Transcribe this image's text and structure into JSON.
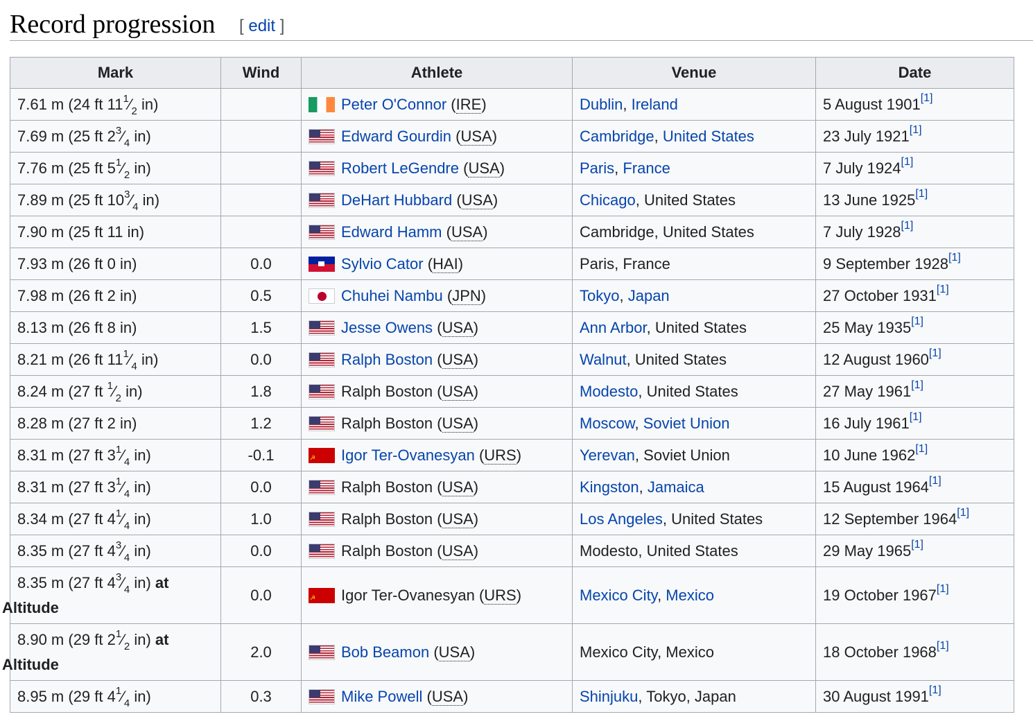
{
  "page": {
    "heading": "Record progression",
    "edit_open": "[ ",
    "edit_label": "edit",
    "edit_close": " ]"
  },
  "table": {
    "headers": [
      "Mark",
      "Wind",
      "Athlete",
      "Venue",
      "Date"
    ],
    "rows": [
      {
        "mark": "7.61 m (24 ft 11",
        "frac": [
          "1",
          "2"
        ],
        "mark_end": " in)",
        "at_label": "",
        "altitude": "",
        "wind": "",
        "flag": "ire",
        "athlete": "Peter O'Connor",
        "athlete_link": true,
        "country": "IRE",
        "city": "Dublin",
        "city_link": true,
        "sep": ", ",
        "region": "Ireland",
        "region_link": true,
        "date": "5 August 1901",
        "ref": "[1]"
      },
      {
        "mark": "7.69 m (25 ft 2",
        "frac": [
          "3",
          "4"
        ],
        "mark_end": " in)",
        "at_label": "",
        "altitude": "",
        "wind": "",
        "flag": "usa",
        "athlete": "Edward Gourdin",
        "athlete_link": true,
        "country": "USA",
        "city": "Cambridge",
        "city_link": true,
        "sep": ", ",
        "region": "United States",
        "region_link": true,
        "date": "23 July 1921",
        "ref": "[1]"
      },
      {
        "mark": "7.76 m (25 ft 5",
        "frac": [
          "1",
          "2"
        ],
        "mark_end": " in)",
        "at_label": "",
        "altitude": "",
        "wind": "",
        "flag": "usa",
        "athlete": "Robert LeGendre",
        "athlete_link": true,
        "country": "USA",
        "city": "Paris",
        "city_link": true,
        "sep": ", ",
        "region": "France",
        "region_link": true,
        "date": "7 July 1924",
        "ref": "[1]"
      },
      {
        "mark": "7.89 m (25 ft 10",
        "frac": [
          "3",
          "4"
        ],
        "mark_end": " in)",
        "at_label": "",
        "altitude": "",
        "wind": "",
        "flag": "usa",
        "athlete": "DeHart Hubbard",
        "athlete_link": true,
        "country": "USA",
        "city": "Chicago",
        "city_link": true,
        "sep": ", ",
        "region": "United States",
        "region_link": false,
        "date": "13 June 1925",
        "ref": "[1]"
      },
      {
        "mark": "7.90 m (25 ft 11 in)",
        "frac": null,
        "mark_end": "",
        "at_label": "",
        "altitude": "",
        "wind": "",
        "flag": "usa",
        "athlete": "Edward Hamm",
        "athlete_link": true,
        "country": "USA",
        "city": "Cambridge",
        "city_link": false,
        "sep": ", ",
        "region": "United States",
        "region_link": false,
        "date": "7 July 1928",
        "ref": "[1]"
      },
      {
        "mark": "7.93 m (26 ft 0 in)",
        "frac": null,
        "mark_end": "",
        "at_label": "",
        "altitude": "",
        "wind": "0.0",
        "flag": "hai",
        "athlete": "Sylvio Cator",
        "athlete_link": true,
        "country": "HAI",
        "city": "Paris",
        "city_link": false,
        "sep": ", ",
        "region": "France",
        "region_link": false,
        "date": "9 September 1928",
        "ref": "[1]"
      },
      {
        "mark": "7.98 m (26 ft 2 in)",
        "frac": null,
        "mark_end": "",
        "at_label": "",
        "altitude": "",
        "wind": "0.5",
        "flag": "jpn",
        "athlete": "Chuhei Nambu",
        "athlete_link": true,
        "country": "JPN",
        "city": "Tokyo",
        "city_link": true,
        "sep": ", ",
        "region": "Japan",
        "region_link": true,
        "date": "27 October 1931",
        "ref": "[1]"
      },
      {
        "mark": "8.13 m (26 ft 8 in)",
        "frac": null,
        "mark_end": "",
        "at_label": "",
        "altitude": "",
        "wind": "1.5",
        "flag": "usa",
        "athlete": "Jesse Owens",
        "athlete_link": true,
        "country": "USA",
        "city": "Ann Arbor",
        "city_link": true,
        "sep": ", ",
        "region": "United States",
        "region_link": false,
        "date": "25 May 1935",
        "ref": "[1]"
      },
      {
        "mark": "8.21 m (26 ft 11",
        "frac": [
          "1",
          "4"
        ],
        "mark_end": " in)",
        "at_label": "",
        "altitude": "",
        "wind": "0.0",
        "flag": "usa",
        "athlete": "Ralph Boston",
        "athlete_link": true,
        "country": "USA",
        "city": "Walnut",
        "city_link": true,
        "sep": ", ",
        "region": "United States",
        "region_link": false,
        "date": "12 August 1960",
        "ref": "[1]"
      },
      {
        "mark": "8.24 m (27 ft ",
        "frac": [
          "1",
          "2"
        ],
        "mark_end": " in)",
        "at_label": "",
        "altitude": "",
        "wind": "1.8",
        "flag": "usa",
        "athlete": "Ralph Boston",
        "athlete_link": false,
        "country": "USA",
        "city": "Modesto",
        "city_link": true,
        "sep": ", ",
        "region": "United States",
        "region_link": false,
        "date": "27 May 1961",
        "ref": "[1]"
      },
      {
        "mark": "8.28 m (27 ft 2 in)",
        "frac": null,
        "mark_end": "",
        "at_label": "",
        "altitude": "",
        "wind": "1.2",
        "flag": "usa",
        "athlete": "Ralph Boston",
        "athlete_link": false,
        "country": "USA",
        "city": "Moscow",
        "city_link": true,
        "sep": ", ",
        "region": "Soviet Union",
        "region_link": true,
        "date": "16 July 1961",
        "ref": "[1]"
      },
      {
        "mark": "8.31 m (27 ft 3",
        "frac": [
          "1",
          "4"
        ],
        "mark_end": " in)",
        "at_label": "",
        "altitude": "",
        "wind": "-0.1",
        "flag": "urs",
        "athlete": "Igor Ter-Ovanesyan",
        "athlete_link": true,
        "country": "URS",
        "city": "Yerevan",
        "city_link": true,
        "sep": ", ",
        "region": "Soviet Union",
        "region_link": false,
        "date": "10 June 1962",
        "ref": "[1]"
      },
      {
        "mark": "8.31 m (27 ft 3",
        "frac": [
          "1",
          "4"
        ],
        "mark_end": " in)",
        "at_label": "",
        "altitude": "",
        "wind": "0.0",
        "flag": "usa",
        "athlete": "Ralph Boston",
        "athlete_link": false,
        "country": "USA",
        "city": "Kingston",
        "city_link": true,
        "sep": ", ",
        "region": "Jamaica",
        "region_link": true,
        "date": "15 August 1964",
        "ref": "[1]"
      },
      {
        "mark": "8.34 m (27 ft 4",
        "frac": [
          "1",
          "4"
        ],
        "mark_end": " in)",
        "at_label": "",
        "altitude": "",
        "wind": "1.0",
        "flag": "usa",
        "athlete": "Ralph Boston",
        "athlete_link": false,
        "country": "USA",
        "city": "Los Angeles",
        "city_link": true,
        "sep": ", ",
        "region": "United States",
        "region_link": false,
        "date": "12 September 1964",
        "ref": "[1]"
      },
      {
        "mark": "8.35 m (27 ft 4",
        "frac": [
          "3",
          "4"
        ],
        "mark_end": " in)",
        "at_label": "",
        "altitude": "",
        "wind": "0.0",
        "flag": "usa",
        "athlete": "Ralph Boston",
        "athlete_link": false,
        "country": "USA",
        "city": "Modesto",
        "city_link": false,
        "sep": ", ",
        "region": "United States",
        "region_link": false,
        "date": "29 May 1965",
        "ref": "[1]"
      },
      {
        "mark": "8.35 m (27 ft 4",
        "frac": [
          "3",
          "4"
        ],
        "mark_end": " in)",
        "at_label": " at",
        "altitude": "Altitude",
        "wind": "0.0",
        "flag": "urs",
        "athlete": "Igor Ter-Ovanesyan",
        "athlete_link": false,
        "country": "URS",
        "city": "Mexico City",
        "city_link": true,
        "sep": ", ",
        "region": "Mexico",
        "region_link": true,
        "date": "19 October 1967",
        "ref": "[1]"
      },
      {
        "mark": "8.90 m (29 ft 2",
        "frac": [
          "1",
          "2"
        ],
        "mark_end": " in)",
        "at_label": " at",
        "altitude": "Altitude",
        "wind": "2.0",
        "flag": "usa",
        "athlete": "Bob Beamon",
        "athlete_link": true,
        "country": "USA",
        "city": "Mexico City",
        "city_link": false,
        "sep": ", ",
        "region": "Mexico",
        "region_link": false,
        "date": "18 October 1968",
        "ref": "[1]"
      },
      {
        "mark": "8.95 m (29 ft 4",
        "frac": [
          "1",
          "4"
        ],
        "mark_end": " in)",
        "at_label": "",
        "altitude": "",
        "wind": "0.3",
        "flag": "usa",
        "athlete": "Mike Powell",
        "athlete_link": true,
        "country": "USA",
        "city": "Shinjuku",
        "city_link": true,
        "sep": ", ",
        "region": "Tokyo, Japan",
        "region_link": false,
        "date": "30 August 1991",
        "ref": "[1]"
      }
    ]
  }
}
